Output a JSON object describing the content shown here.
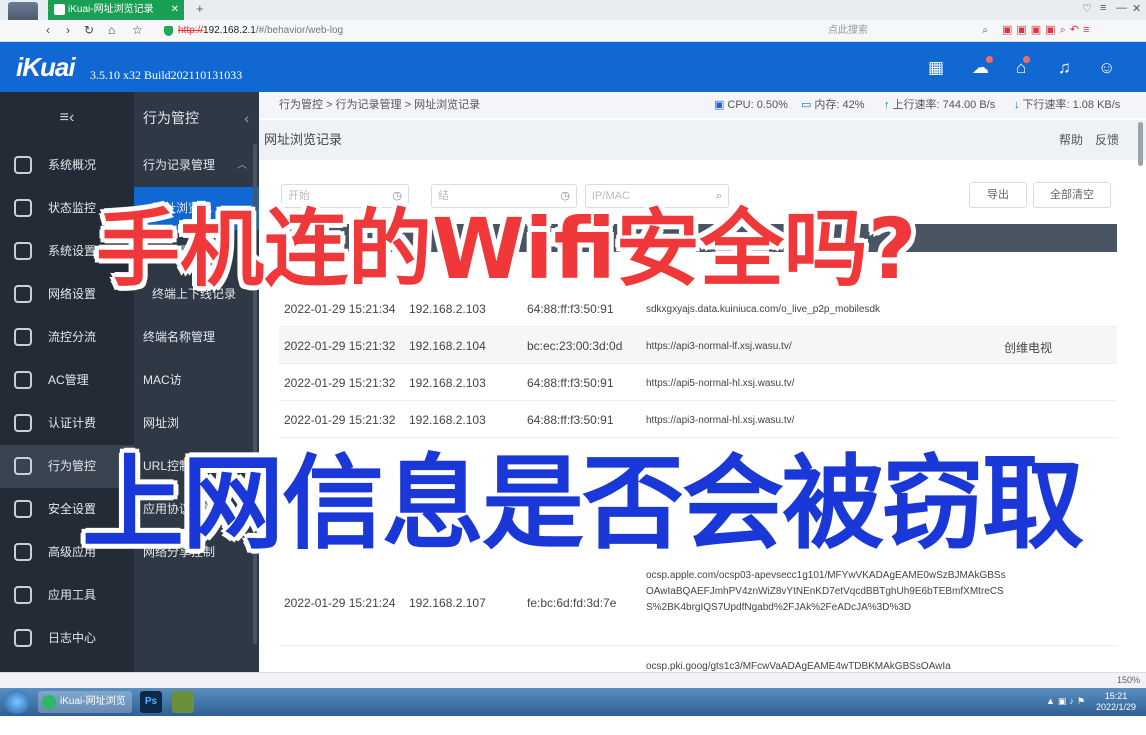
{
  "browser": {
    "tab_title": "iKuai-网址浏览记录",
    "url_protocol": "http://",
    "url_host": "192.168.2.1",
    "url_path": "/#/behavior/web-log",
    "search_placeholder": "点此搜索"
  },
  "app": {
    "logo": "iKuai",
    "version": "3.5.10 x32 Build202110131033"
  },
  "sidebar_main": [
    {
      "label": "系统概况",
      "icon": "dashboard-icon"
    },
    {
      "label": "状态监控",
      "icon": "monitor-icon"
    },
    {
      "label": "系统设置",
      "icon": "gear-icon"
    },
    {
      "label": "网络设置",
      "icon": "network-icon"
    },
    {
      "label": "流控分流",
      "icon": "sliders-icon"
    },
    {
      "label": "AC管理",
      "icon": "wifi-icon"
    },
    {
      "label": "认证计费",
      "icon": "auth-icon"
    },
    {
      "label": "行为管控",
      "icon": "behavior-icon",
      "active": true
    },
    {
      "label": "安全设置",
      "icon": "firewall-icon"
    },
    {
      "label": "高级应用",
      "icon": "check-icon"
    },
    {
      "label": "应用工具",
      "icon": "tools-icon"
    },
    {
      "label": "日志中心",
      "icon": "log-icon"
    }
  ],
  "sidebar_sub": {
    "title": "行为管控",
    "items": [
      {
        "label": "行为记录管理",
        "type": "group"
      },
      {
        "label": "网址浏览记",
        "type": "sub",
        "active": true
      },
      {
        "label": "IM记录",
        "type": "sub"
      },
      {
        "label": "终端上下线记录",
        "type": "sub"
      },
      {
        "label": "终端名称管理",
        "type": "item"
      },
      {
        "label": "MAC访",
        "type": "item"
      },
      {
        "label": "网址浏",
        "type": "item"
      },
      {
        "label": "URL控制",
        "type": "item"
      },
      {
        "label": "应用协议控制",
        "type": "item"
      },
      {
        "label": "网络分享控制",
        "type": "item"
      }
    ]
  },
  "topstrip": {
    "breadcrumb": "行为管控 > 行为记录管理 > 网址浏览记录",
    "cpu": "CPU: 0.50%",
    "mem": "内存: 42%",
    "upload": "上行速率: 744.00 B/s",
    "download": "下行速率: 1.08 KB/s"
  },
  "page": {
    "title": "网址浏览记录",
    "help": "帮助",
    "feedback": "反馈",
    "filter_time_start": "开始",
    "filter_time_end": "结",
    "filter_search": "IP/MAC",
    "export": "导出",
    "clear_all": "全部清空"
  },
  "rows": [
    {
      "time": "2022-01-29 15:21:34",
      "ip": "192.168.2.103",
      "mac": "64:88:ff:f3:50:91",
      "url": "sdkxgxyajs.data.kuiniuca.com/o_live_p2p_mobilesdk",
      "terminal": ""
    },
    {
      "time": "2022-01-29 15:21:32",
      "ip": "192.168.2.104",
      "mac": "bc:ec:23:00:3d:0d",
      "url": "https://api3-normal-lf.xsj.wasu.tv/",
      "terminal": "创维电视"
    },
    {
      "time": "2022-01-29 15:21:32",
      "ip": "192.168.2.103",
      "mac": "64:88:ff:f3:50:91",
      "url": "https://api5-normal-hl.xsj.wasu.tv/",
      "terminal": ""
    },
    {
      "time": "2022-01-29 15:21:32",
      "ip": "192.168.2.103",
      "mac": "64:88:ff:f3:50:91",
      "url": "https://api3-normal-hl.xsj.wasu.tv/",
      "terminal": ""
    },
    {
      "time": "2022-01-29 15:21:24",
      "ip": "192.168.2.107",
      "mac": "fe:bc:6d:fd:3d:7e",
      "url": "ocsp.apple.com/ocsp03-apevsecc1g101/MFYwVKADAgEAME0wSzBJMAkGBSsOAwIaBQAEFJmhPV4znWiZ8vYtNEnKD7etVqcdBBTghUh9E6bTEBmfXMtreCSS%2BK4brgIQS7UpdfNgabd%2FJAk%2FeADcJA%3D%3D",
      "terminal": ""
    },
    {
      "time": "",
      "ip": "",
      "mac": "",
      "url": "ocsp.pki.goog/gts1c3/MFcwVaADAgEAME4wTDBKMAkGBSsOAwIa",
      "terminal": ""
    }
  ],
  "overlay": {
    "line1": "手机连的Wifi安全吗?",
    "line2": "上网信息是否会被窃取"
  },
  "statusbar": {
    "zoom": "150%"
  },
  "taskbar": {
    "active_task": "iKuai-网址浏览记...",
    "ps_label": "Ps",
    "time": "15:21",
    "date": "2022/1/29"
  }
}
